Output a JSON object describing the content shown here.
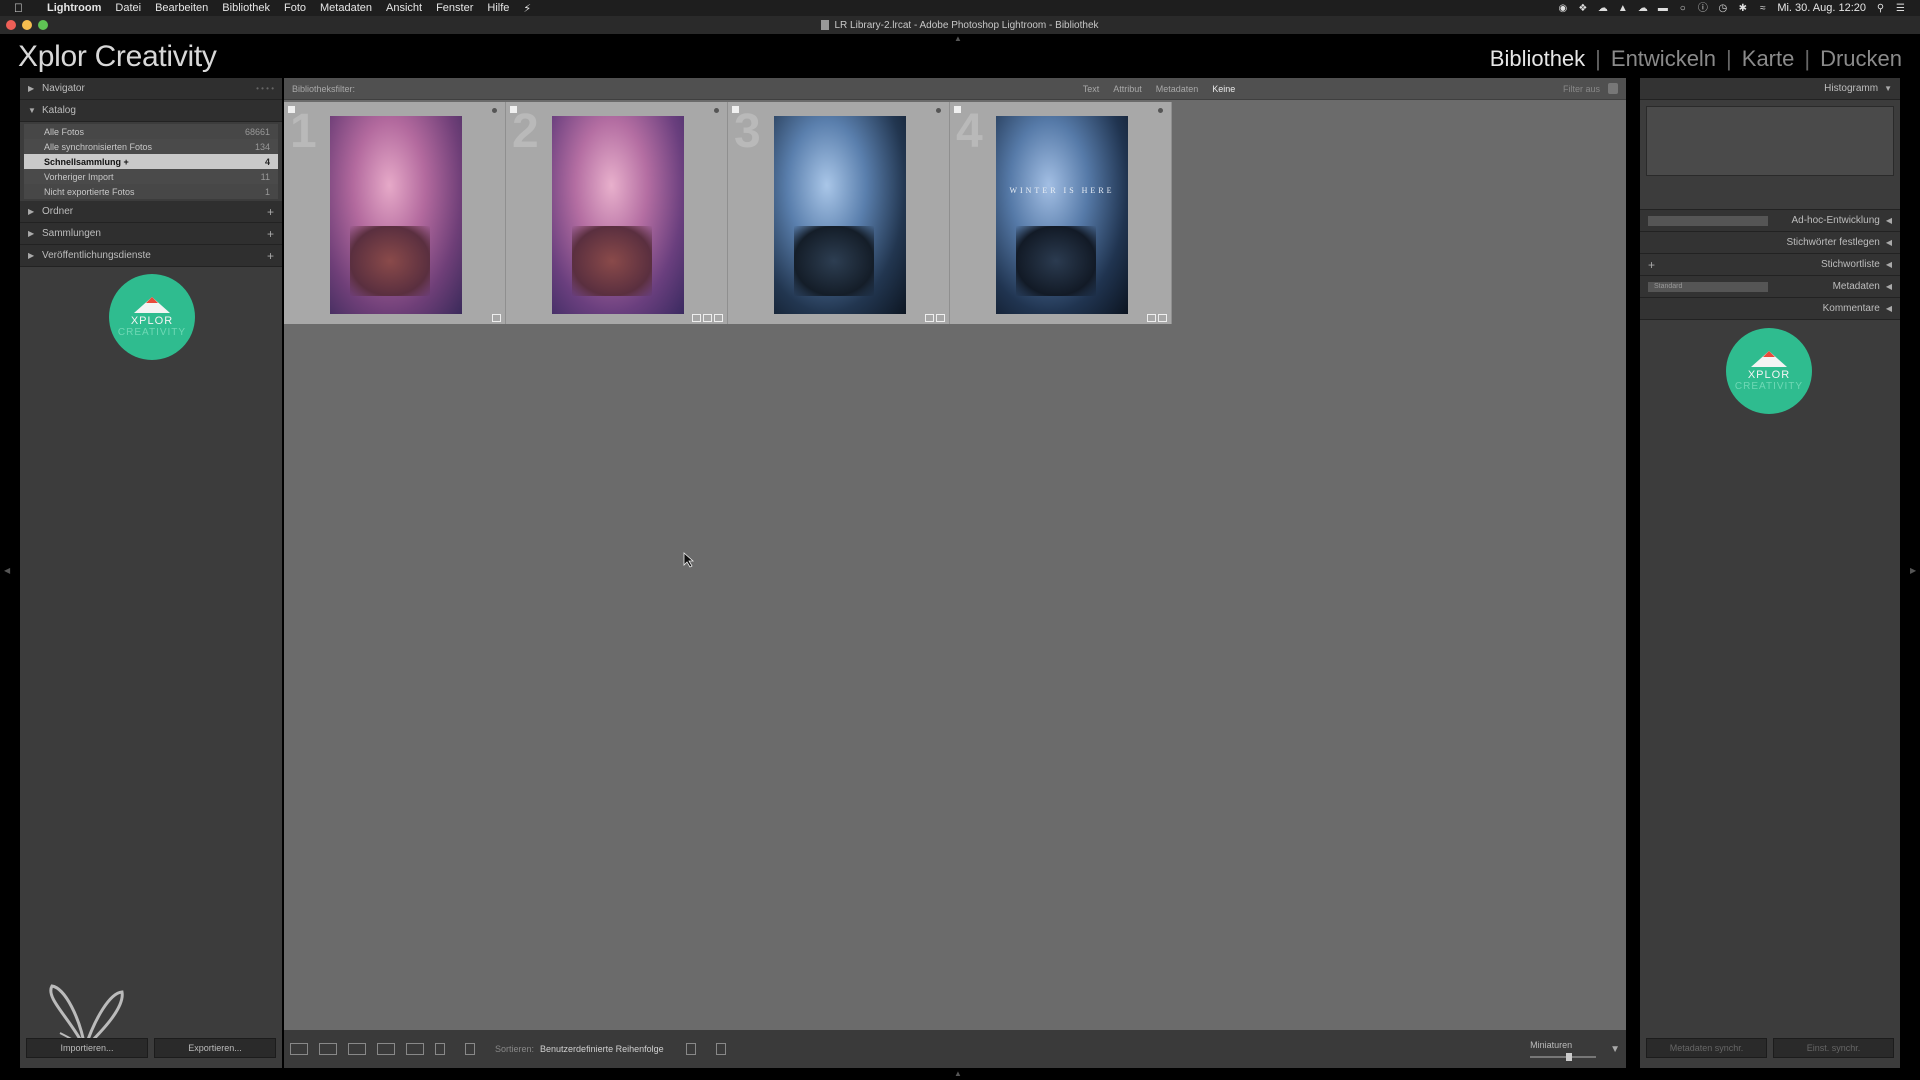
{
  "menubar": {
    "app": "Lightroom",
    "items": [
      "Datei",
      "Bearbeiten",
      "Bibliothek",
      "Foto",
      "Metadaten",
      "Ansicht",
      "Fenster",
      "Hilfe"
    ],
    "clock": "Mi. 30. Aug. 12:20"
  },
  "window": {
    "title": "LR Library-2.lrcat - Adobe Photoshop Lightroom - Bibliothek"
  },
  "identity": {
    "plate": "Xplor Creativity",
    "modules": [
      "Bibliothek",
      "Entwickeln",
      "Karte",
      "Drucken"
    ],
    "active_module": "Bibliothek"
  },
  "left_panel": {
    "navigator": "Navigator",
    "katalog": "Katalog",
    "catalog_items": [
      {
        "label": "Alle Fotos",
        "count": "68661"
      },
      {
        "label": "Alle synchronisierten Fotos",
        "count": "134"
      },
      {
        "label": "Schnellsammlung +",
        "count": "4"
      },
      {
        "label": "Vorheriger Import",
        "count": "11"
      },
      {
        "label": "Nicht exportierte Fotos",
        "count": "1"
      }
    ],
    "ordner": "Ordner",
    "sammlungen": "Sammlungen",
    "veroeffentlichung": "Veröffentlichungsdienste",
    "import_button": "Importieren...",
    "export_button": "Exportieren..."
  },
  "logo": {
    "line1": "XPLOR",
    "line2": "CREATIVITY"
  },
  "filterbar": {
    "label": "Bibliotheksfilter:",
    "options": [
      "Text",
      "Attribut",
      "Metadaten",
      "Keine"
    ],
    "active": "Keine",
    "filter_off": "Filter aus"
  },
  "grid": {
    "cells": [
      {
        "index": "1",
        "tone": "magenta",
        "overlay": ""
      },
      {
        "index": "2",
        "tone": "magenta",
        "overlay": ""
      },
      {
        "index": "3",
        "tone": "blue",
        "overlay": ""
      },
      {
        "index": "4",
        "tone": "blue",
        "overlay": "WINTER IS HERE"
      }
    ]
  },
  "toolbar": {
    "sort_label": "Sortieren:",
    "sort_value": "Benutzerdefinierte Reihenfolge",
    "thumbnails_label": "Miniaturen",
    "thumbnail_size": 0.6
  },
  "right_panel": {
    "histogram": "Histogramm",
    "adhoc": "Ad-hoc-Entwicklung",
    "stichwoerter_festlegen": "Stichwörter festlegen",
    "stichwortliste": "Stichwortliste",
    "metadaten": "Metadaten",
    "metadata_preset": "Standard",
    "kommentare": "Kommentare",
    "sync_button": "Metadaten synchr.",
    "settings_button": "Einst. synchr."
  },
  "colors": {
    "accent_logo": "#2fbc8f",
    "panel": "#3c3c3c",
    "grid_bg": "#6b6b6b"
  }
}
